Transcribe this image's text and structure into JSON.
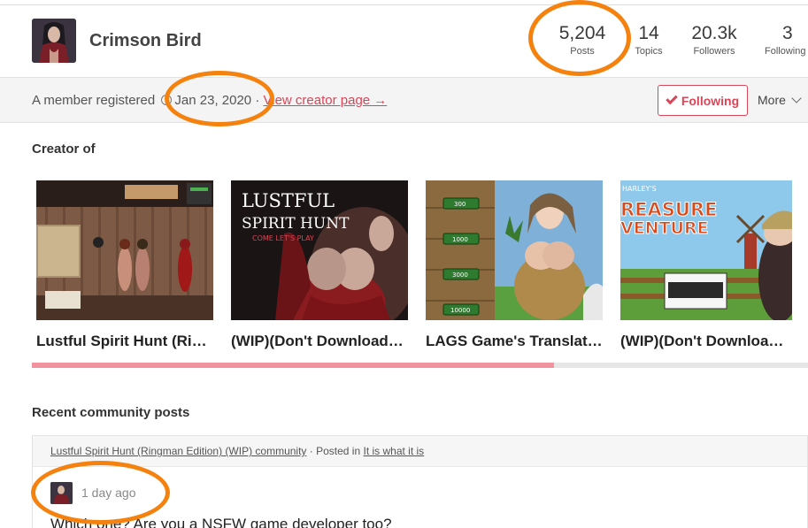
{
  "profile": {
    "username": "Crimson Bird",
    "stats": [
      {
        "value": "5,204",
        "label": "Posts"
      },
      {
        "value": "14",
        "label": "Topics"
      },
      {
        "value": "20.3k",
        "label": "Followers"
      },
      {
        "value": "3",
        "label": "Following"
      }
    ]
  },
  "subbar": {
    "registered_text": "A member registered",
    "registered_date": "Jan 23, 2020",
    "separator": "·",
    "creator_link": "View creator page →",
    "follow_label": "Following",
    "more_label": "More"
  },
  "creator_section": {
    "title": "Creator of",
    "games": [
      {
        "title": "Lustful Spirit Hunt (Ringman Edition)"
      },
      {
        "title": "(WIP)(Don't Download) Lustful Spirit Hunt"
      },
      {
        "title": "LAGS Game's Translation"
      },
      {
        "title": "(WIP)(Don't Download) Harley's Treasure Adventure"
      }
    ],
    "scroll_progress": 0.673
  },
  "community_section": {
    "title": "Recent community posts",
    "post": {
      "community_link": "Lustful Spirit Hunt (Ringman Edition) (WIP) community",
      "posted_in_text": "· Posted in",
      "topic_link": "It is what it is",
      "time_ago": "1 day ago",
      "text": "Which one? Are you a NSFW game developer too?"
    }
  },
  "thumb_text": {
    "card2_line1": "LUSTFUL",
    "card2_line2": "SPIRIT HUNT",
    "card2_line3": "COME LET'S PLAY",
    "card3_buttons": [
      "300",
      "1000",
      "3000",
      "10000"
    ],
    "card4_tag": "HARLEY'S",
    "card4_line1": "REASURE",
    "card4_line2": "VENTURE"
  },
  "colors": {
    "accent": "#d94658",
    "annotation": "#f5820e",
    "progress_fill": "#f0939e"
  }
}
